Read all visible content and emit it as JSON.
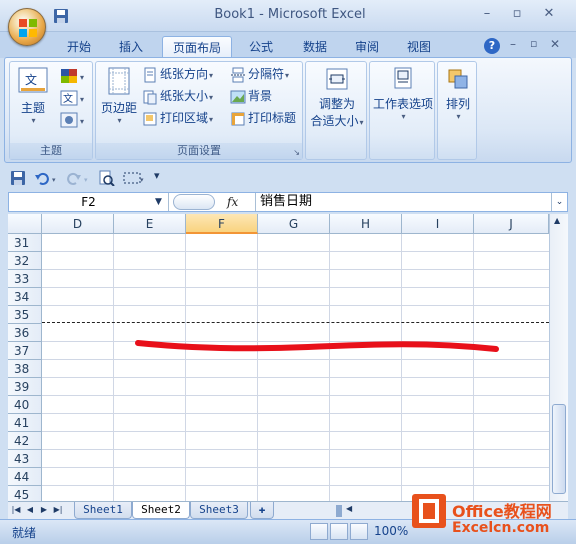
{
  "app": {
    "title": "Book1 - Microsoft Excel"
  },
  "ribbon_tabs": [
    {
      "label": "开始"
    },
    {
      "label": "插入"
    },
    {
      "label": "页面布局"
    },
    {
      "label": "公式"
    },
    {
      "label": "数据"
    },
    {
      "label": "审阅"
    },
    {
      "label": "视图"
    }
  ],
  "ribbon": {
    "theme": {
      "themes_label": "主题",
      "group_label": "主题"
    },
    "page_setup": {
      "margins_label": "页边距",
      "orientation_label": "纸张方向",
      "size_label": "纸张大小",
      "print_area_label": "打印区域",
      "breaks_label": "分隔符",
      "background_label": "背景",
      "print_titles_label": "打印标题",
      "group_label": "页面设置"
    },
    "scale": {
      "line1": "调整为",
      "line2": "合适大小"
    },
    "sheet_options": {
      "label": "工作表选项"
    },
    "arrange": {
      "label": "排列"
    }
  },
  "formula_bar": {
    "name_box": "F2",
    "fx": "fx",
    "formula": "销售日期"
  },
  "grid": {
    "columns": [
      "D",
      "E",
      "F",
      "G",
      "H",
      "I",
      "J"
    ],
    "selected_column": "F",
    "rows": [
      "31",
      "32",
      "33",
      "34",
      "35",
      "36",
      "37",
      "38",
      "39",
      "40",
      "41",
      "42",
      "43",
      "44",
      "45"
    ]
  },
  "sheets": [
    {
      "label": "Sheet1"
    },
    {
      "label": "Sheet2"
    },
    {
      "label": "Sheet3"
    }
  ],
  "active_sheet": "Sheet2",
  "status": {
    "text": "就绪",
    "zoom": "100%"
  },
  "watermark": {
    "title": "Office教程网",
    "url": "Excelcn.com"
  },
  "colors": {
    "accent": "#15428b",
    "annotation": "#e8101a",
    "watermark": "#e8511c"
  }
}
